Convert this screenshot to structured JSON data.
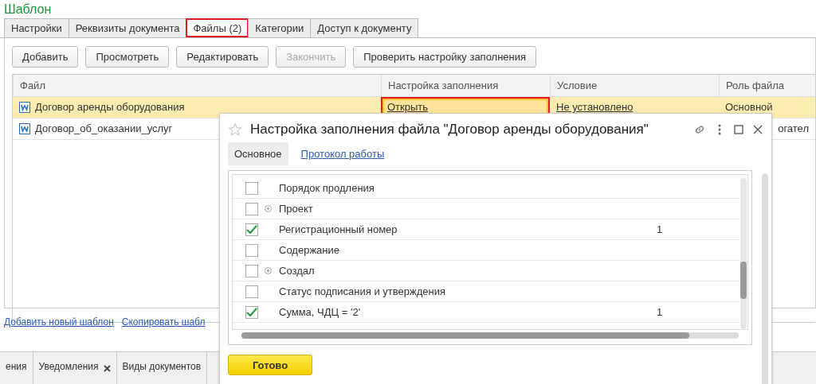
{
  "title": "Шаблон",
  "tabs": [
    {
      "label": "Настройки",
      "selected": false,
      "highlighted": false
    },
    {
      "label": "Реквизиты документа",
      "selected": false,
      "highlighted": false
    },
    {
      "label": "Файлы (2)",
      "selected": true,
      "highlighted": true
    },
    {
      "label": "Категории",
      "selected": false,
      "highlighted": false
    },
    {
      "label": "Доступ к документу",
      "selected": false,
      "highlighted": false
    }
  ],
  "buttons": [
    {
      "label": "Добавить",
      "disabled": false
    },
    {
      "label": "Просмотреть",
      "disabled": false
    },
    {
      "label": "Редактировать",
      "disabled": false
    },
    {
      "label": "Закончить",
      "disabled": true
    },
    {
      "label": "Проверить настройку заполнения",
      "disabled": false
    }
  ],
  "table": {
    "columns": [
      "Файл",
      "Настройка заполнения",
      "Условие",
      "Роль файла"
    ],
    "rows": [
      {
        "file": "Договор аренды оборудования",
        "setting": "Открыть",
        "setting_highlighted": true,
        "condition": "Не установлено",
        "role": "Основной",
        "selected": true
      },
      {
        "file": "Договор_об_оказании_услуг",
        "role": "огател",
        "selected": false
      }
    ]
  },
  "links": [
    "Добавить новый шаблон",
    "Скопировать шабл"
  ],
  "bottom_tabs": [
    {
      "label": "ения",
      "closable": false
    },
    {
      "label": "Уведомления",
      "closable": true
    },
    {
      "label": "Виды документов",
      "closable": false
    }
  ],
  "dialog": {
    "title": "Настройка заполнения файла \"Договор аренды оборудования\"",
    "tabs": [
      {
        "label": "Основное",
        "selected": true
      },
      {
        "label": "Протокол работы",
        "selected": false
      }
    ],
    "rows": [
      {
        "label": "Порядок продления",
        "checked": false,
        "expandable": false
      },
      {
        "label": "Проект",
        "checked": false,
        "expandable": true
      },
      {
        "label": "Регистрационный номер",
        "checked": true,
        "expandable": false,
        "count": "1"
      },
      {
        "label": "Содержание",
        "checked": false,
        "expandable": false
      },
      {
        "label": "Создал",
        "checked": false,
        "expandable": true
      },
      {
        "label": "Статус подписания и утверждения",
        "checked": false,
        "expandable": false
      },
      {
        "label": "Сумма, ЧДЦ = '2'",
        "checked": true,
        "expandable": false,
        "count": "1"
      }
    ],
    "button": "Готово"
  }
}
